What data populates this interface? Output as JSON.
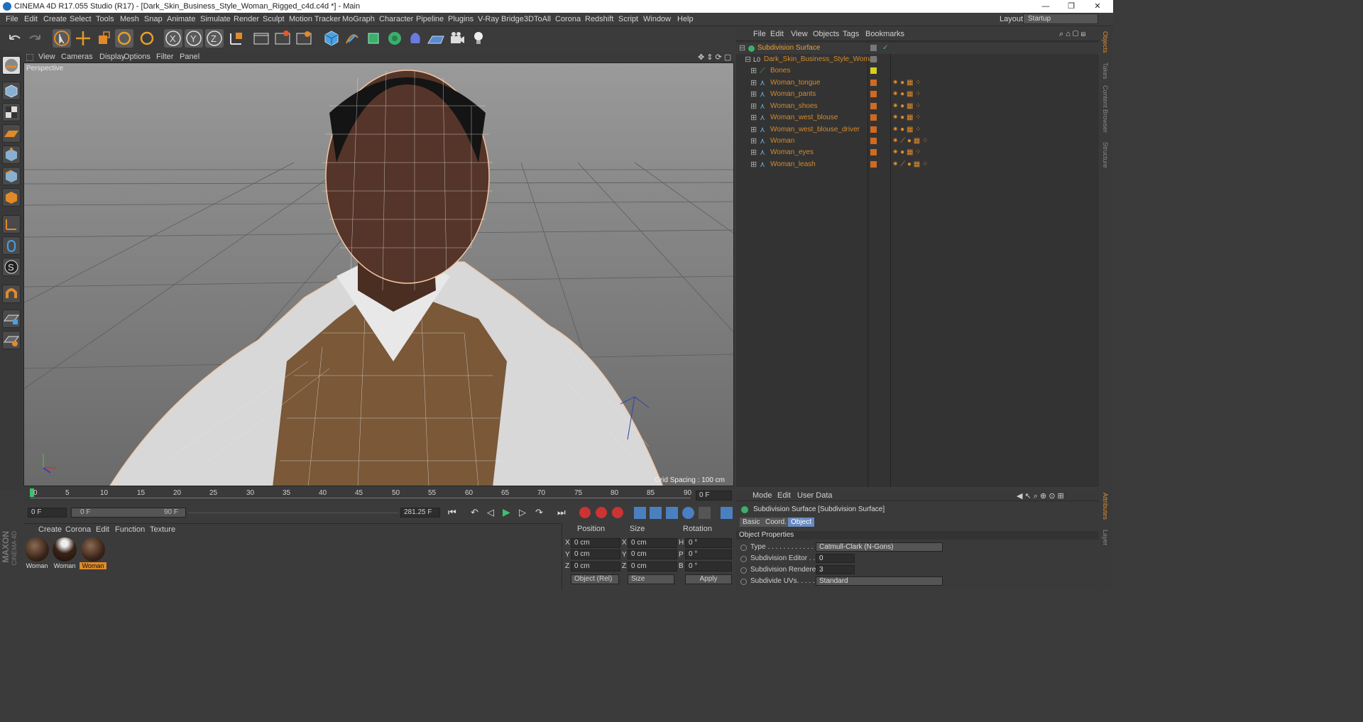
{
  "window": {
    "title": "CINEMA 4D R17.055 Studio (R17) - [Dark_Skin_Business_Style_Woman_Rigged_c4d.c4d *] - Main",
    "minimize": "—",
    "restore": "❐",
    "close": "✕"
  },
  "menubar": {
    "items": [
      "File",
      "Edit",
      "Create",
      "Select",
      "Tools",
      "Mesh",
      "Snap",
      "Animate",
      "Simulate",
      "Render",
      "Sculpt",
      "Motion Tracker",
      "MoGraph",
      "Character",
      "Pipeline",
      "Plugins",
      "V-Ray Bridge",
      "3DToAll",
      "Corona",
      "Redshift",
      "Script",
      "Window",
      "Help"
    ],
    "layout_label": "Layout:",
    "layout_value": "Startup"
  },
  "viewport": {
    "menu": [
      "View",
      "Cameras",
      "Display",
      "Options",
      "Filter",
      "Panel"
    ],
    "camera_label": "Perspective",
    "grid_spacing": "Grid Spacing : 100 cm"
  },
  "timeline": {
    "ticks": [
      "0",
      "5",
      "10",
      "15",
      "20",
      "25",
      "30",
      "35",
      "40",
      "45",
      "50",
      "55",
      "60",
      "65",
      "70",
      "75",
      "80",
      "85",
      "90"
    ],
    "current_frame": "0 F"
  },
  "transport": {
    "start": "0 F",
    "range_start": "0 F",
    "range_end": "90 F",
    "end": "281.25 F"
  },
  "material_manager": {
    "menu": [
      "Create",
      "Corona",
      "Edit",
      "Function",
      "Texture"
    ],
    "materials": [
      "Woman",
      "Woman",
      "Woman"
    ]
  },
  "coordinates": {
    "headers": [
      "Position",
      "Size",
      "Rotation"
    ],
    "rows": [
      {
        "axis": "X",
        "pos": "0 cm",
        "saxis": "X",
        "size": "0 cm",
        "raxis": "H",
        "rot": "0 °"
      },
      {
        "axis": "Y",
        "pos": "0 cm",
        "saxis": "Y",
        "size": "0 cm",
        "raxis": "P",
        "rot": "0 °"
      },
      {
        "axis": "Z",
        "pos": "0 cm",
        "saxis": "Z",
        "size": "0 cm",
        "raxis": "B",
        "rot": "0 °"
      }
    ],
    "mode": "Object (Rel)",
    "size_mode": "Size",
    "apply": "Apply"
  },
  "object_manager": {
    "menu": [
      "File",
      "Edit",
      "View",
      "Objects",
      "Tags",
      "Bookmarks"
    ],
    "objects": [
      "Subdivision Surface",
      "Dark_Skin_Business_Style_Woman",
      "Bones",
      "Woman_tongue",
      "Woman_pants",
      "Woman_shoes",
      "Woman_west_blouse",
      "Woman_west_blouse_driver",
      "Woman",
      "Woman_eyes",
      "Woman_leash"
    ]
  },
  "attributes": {
    "menu": [
      "Mode",
      "Edit",
      "User Data"
    ],
    "title": "Subdivision Surface [Subdivision Surface]",
    "tabs": [
      "Basic",
      "Coord.",
      "Object"
    ],
    "section": "Object Properties",
    "props": [
      {
        "label": "Type . . . . . . . . . . . . . .",
        "value": "Catmull-Clark (N-Gons)"
      },
      {
        "label": "Subdivision Editor . .",
        "value": "0"
      },
      {
        "label": "Subdivision Renderer",
        "value": "3"
      },
      {
        "label": "Subdivide UVs. . . . . .",
        "value": "Standard"
      }
    ]
  },
  "right_tabs": [
    "Objects",
    "Takes",
    "Content Browser",
    "Structure",
    "Attributes",
    "Layer"
  ],
  "brand": {
    "maxon": "MAXON",
    "c4d": "CINEMA 4D"
  }
}
